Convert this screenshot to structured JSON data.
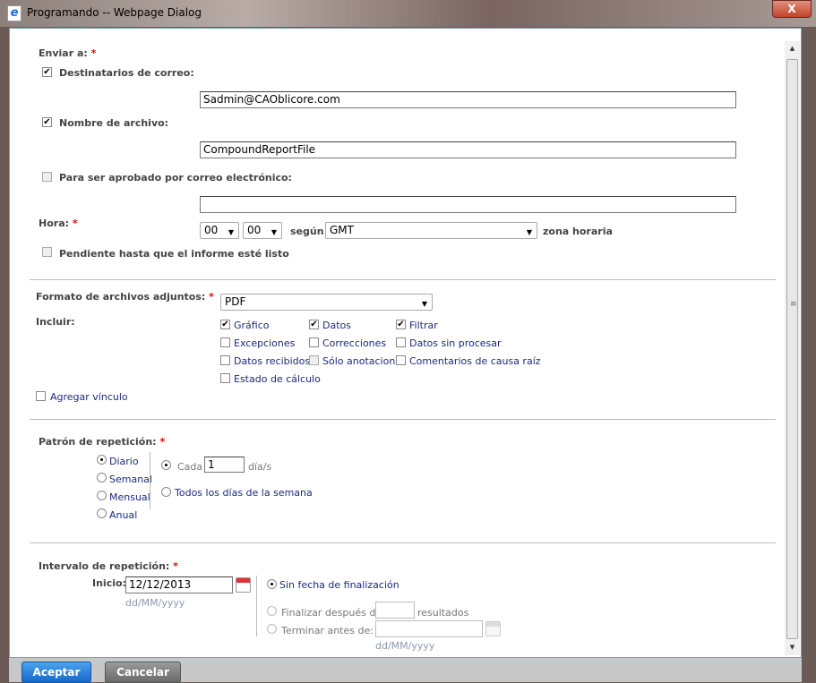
{
  "window": {
    "title": "Programando -- Webpage Dialog",
    "close": "X"
  },
  "send": {
    "label": "Enviar a:",
    "required": "*",
    "recipients_label": "Destinatarios de correo:",
    "recipients_value": "Sadmin@CAOblicore.com",
    "filename_label": "Nombre de archivo:",
    "filename_value": "CompoundReportFile",
    "approve_label": "Para ser aprobado por correo electrónico:",
    "approve_value": ""
  },
  "time": {
    "label": "Hora:",
    "required": "*",
    "hour": "00",
    "minute": "00",
    "segun": "según",
    "zone": "GMT",
    "zone_suffix": "zona horaria",
    "pending_label": "Pendiente hasta que el informe esté listo"
  },
  "format": {
    "label": "Formato de archivos adjuntos:",
    "required": "*",
    "value": "PDF",
    "include_label": "Incluir:",
    "options": [
      {
        "label": "Gráfico",
        "checked": true
      },
      {
        "label": "Datos",
        "checked": true
      },
      {
        "label": "Filtrar",
        "checked": true
      },
      {
        "label": "Excepciones",
        "checked": false
      },
      {
        "label": "Correcciones",
        "checked": false
      },
      {
        "label": "Datos sin procesar",
        "checked": false
      },
      {
        "label": "Datos recibidos",
        "checked": false
      },
      {
        "label": "Sólo anotaciones",
        "checked": false
      },
      {
        "label": "Comentarios de causa raíz",
        "checked": false
      },
      {
        "label": "Estado de cálculo",
        "checked": false
      }
    ],
    "add_link_label": "Agregar vínculo"
  },
  "pattern": {
    "label": "Patrón de repetición:",
    "required": "*",
    "types": [
      "Diario",
      "Semanal",
      "Mensual",
      "Anual"
    ],
    "selected": "Diario",
    "each_label": "Cada",
    "each_value": "1",
    "each_unit": "día/s",
    "weekdays_label": "Todos los días de la semana"
  },
  "range": {
    "label": "Intervalo de repetición:",
    "required": "*",
    "start_label": "Inicio:",
    "start_value": "12/12/2013",
    "date_format": "dd/MM/yyyy",
    "no_end": "Sin fecha de finalización",
    "end_after": "Finalizar después de:",
    "end_after_suffix": "resultados",
    "end_before": "Terminar antes de:",
    "end_date_format": "dd/MM/yyyy"
  },
  "buttons": {
    "ok": "Aceptar",
    "cancel": "Cancelar"
  }
}
